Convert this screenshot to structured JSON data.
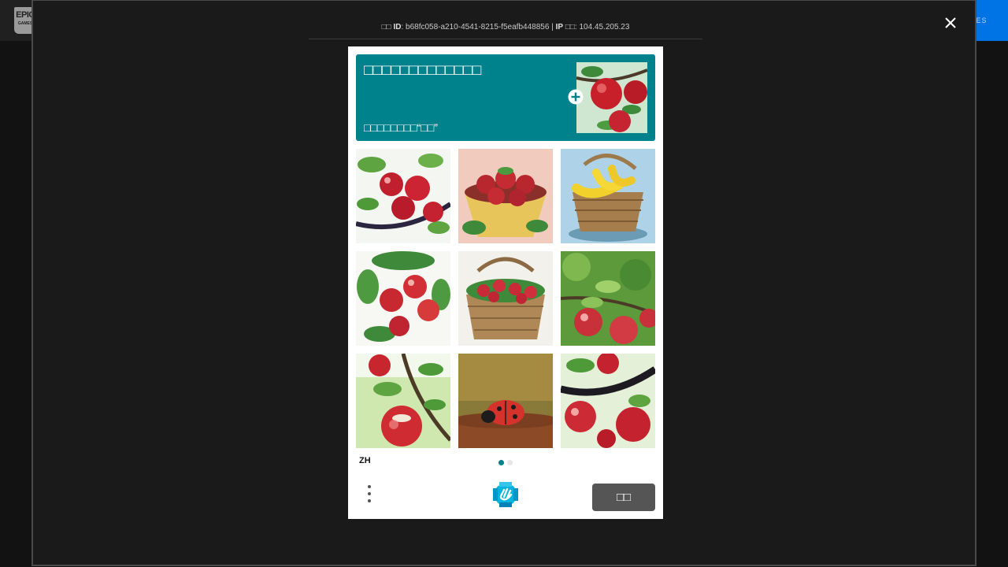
{
  "background": {
    "logo_text_top": "EPIC",
    "logo_text_bottom": "GAMES",
    "header_button_text": "IES"
  },
  "captcha_info": {
    "id_prefix": "□□",
    "id_label": "ID",
    "id_value": "b68fc058-a210-4541-8215-f5eafb448856",
    "separator": "|",
    "ip_label": "IP",
    "ip_suffix_label": "□□",
    "ip_value": "104.45.205.23"
  },
  "prompt": {
    "title": "□□□□□□□□□□□□□",
    "subtitle": "□□□□□□□□“□□”",
    "example_image": "apple"
  },
  "tiles": [
    {
      "subject": "apples-on-branch"
    },
    {
      "subject": "strawberries-in-bowl"
    },
    {
      "subject": "bananas-in-basket"
    },
    {
      "subject": "apples-on-tree"
    },
    {
      "subject": "strawberries-in-basket"
    },
    {
      "subject": "apples-with-leaves"
    },
    {
      "subject": "apple-on-branch"
    },
    {
      "subject": "ladybug-on-soil"
    },
    {
      "subject": "apples-on-dark-branch"
    }
  ],
  "footer": {
    "language": "ZH",
    "page_dots": [
      true,
      false
    ],
    "submit_label": "□□"
  },
  "colors": {
    "prompt_bg": "#00828c",
    "submit_bg": "#555555",
    "dot_active": "#00828c",
    "dot_inactive": "#e6e6e6",
    "header_accent": "#0074e4"
  }
}
